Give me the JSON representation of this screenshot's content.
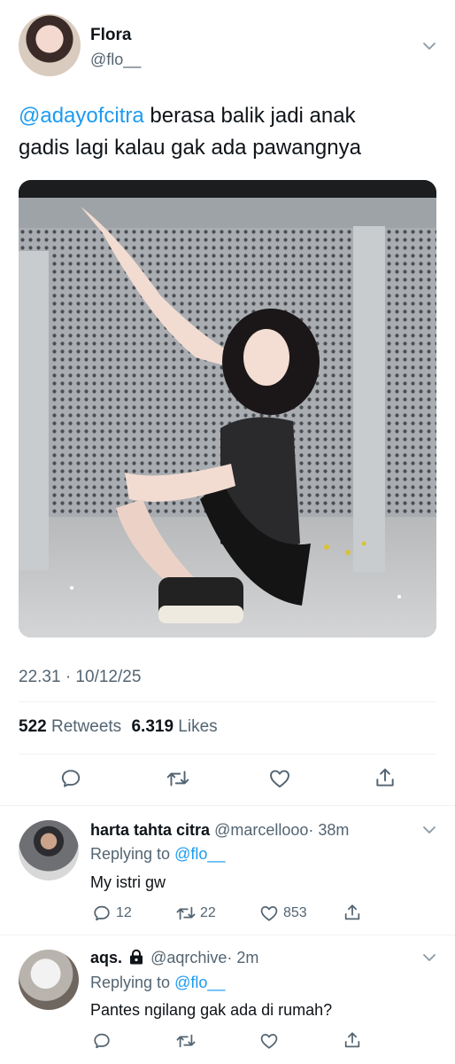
{
  "tweet": {
    "author_name": "Flora",
    "author_handle": "@flo__",
    "mention": "@adayofcitra",
    "text_line1": " berasa balik jadi anak",
    "text_line2": "gadis lagi kalau gak ada pawangnya",
    "timestamp": "22.31 · 10/12/25",
    "retweets_count": "522",
    "retweets_label": "Retweets",
    "likes_count": "6.319",
    "likes_label": "Likes"
  },
  "replies": [
    {
      "name": "harta tahta citra",
      "handle": "@marcellooo",
      "time": "· 38m",
      "replying_label": "Replying to",
      "replying_to": "@flo__",
      "text": "My istri gw",
      "reply_count": "12",
      "retweet_count": "22",
      "like_count": "853"
    },
    {
      "name": "aqs.",
      "handle": "@aqrchive",
      "time": "· 2m",
      "replying_label": "Replying to",
      "replying_to": "@flo__",
      "text": "Pantes ngilang gak ada di rumah?"
    }
  ],
  "colors": {
    "accent": "#1d9bf0",
    "secondary_text": "#536471",
    "divider": "#eff3f4"
  },
  "icons": [
    "chevron-down-icon",
    "reply-icon",
    "retweet-icon",
    "like-icon",
    "share-icon",
    "lock-icon"
  ]
}
